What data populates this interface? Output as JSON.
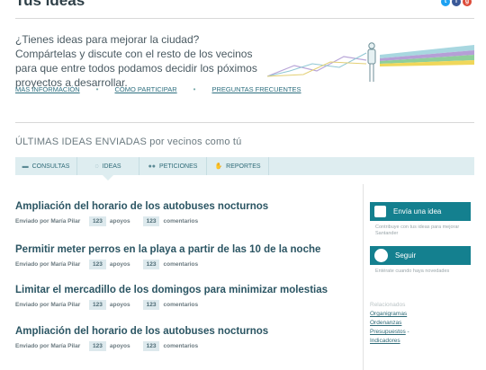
{
  "header": {
    "title": "Tus ideas",
    "social": [
      {
        "name": "twitter-icon",
        "glyph": "t",
        "color": "#1da1f2"
      },
      {
        "name": "facebook-icon",
        "glyph": "f",
        "color": "#3b5998"
      },
      {
        "name": "googleplus-icon",
        "glyph": "g",
        "color": "#dd4b39"
      }
    ]
  },
  "intro": {
    "text": "¿Tienes ideas para mejorar la ciudad? Compártelas y discute con el resto de los vecinos para que entre todos podamos decidir los póximos proyectos a desarrollar.",
    "links": [
      "MÁS INFORMACIÓN",
      "CÓMO PARTICIPAR",
      "PREGUNTAS FRECUENTES"
    ],
    "separator": "•"
  },
  "recent": {
    "title": "ÚLTIMAS IDEAS ENVIADAS por vecinos como tú",
    "tabs": [
      {
        "label": "CONSULTAS",
        "icon": "chat-icon",
        "glyph": "▬"
      },
      {
        "label": "IDEAS",
        "icon": "lightbulb-icon",
        "glyph": "◌"
      },
      {
        "label": "PETICIONES",
        "icon": "group-icon",
        "glyph": "●●"
      },
      {
        "label": "REPORTES",
        "icon": "hand-icon",
        "glyph": "✋"
      }
    ]
  },
  "ideas": [
    {
      "title": "Ampliación del horario de los autobuses nocturnos",
      "author": "Enviado por María Pilar",
      "votes": "123",
      "votes_label": "apoyos",
      "comments": "123",
      "comments_label": "comentarios"
    },
    {
      "title": "Permitir meter perros en la playa a partir de las 10 de la noche",
      "author": "Enviado por María Pilar",
      "votes": "123",
      "votes_label": "apoyos",
      "comments": "123",
      "comments_label": "comentarios"
    },
    {
      "title": "Limitar el mercadillo de los domingos para minimizar molestias",
      "author": "Enviado por María Pilar",
      "votes": "123",
      "votes_label": "apoyos",
      "comments": "123",
      "comments_label": "comentarios"
    },
    {
      "title": "Ampliación del horario de los autobuses nocturnos",
      "author": "Enviado por María Pilar",
      "votes": "123",
      "votes_label": "apoyos",
      "comments": "123",
      "comments_label": "comentarios"
    }
  ],
  "sidebar": {
    "send_idea": {
      "label": "Envía una idea",
      "note": "Contribuye con tus ideas para mejorar Santander"
    },
    "follow": {
      "label": "Seguir",
      "note": "Entérate cuando haya novedades"
    },
    "related_label": "Relacionados",
    "related_links": [
      "Organigramas",
      "Ordenanzas",
      "Presupuestos",
      "Indicadores"
    ]
  },
  "colors": {
    "primary": "#14808f",
    "tab_bg": "#deedf0",
    "title": "#2b5563"
  }
}
